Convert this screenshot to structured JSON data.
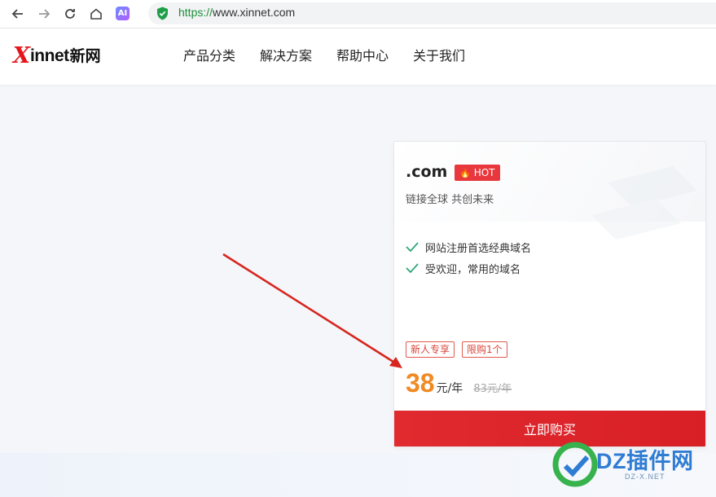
{
  "browser": {
    "url_scheme": "https://",
    "url_rest": "www.xinnet.com",
    "ai_label": "AI"
  },
  "site": {
    "logo_x": "X",
    "logo_rest": "innet",
    "logo_cn": "新网",
    "nav": [
      "产品分类",
      "解决方案",
      "帮助中心",
      "关于我们"
    ]
  },
  "card": {
    "title": ".com",
    "hot_label": "HOT",
    "subtitle": "链接全球 共创未来",
    "features": [
      "网站注册首选经典域名",
      "受欢迎，常用的域名"
    ],
    "tags": [
      "新人专享",
      "限购1个"
    ],
    "price": "38",
    "price_unit": "元/年",
    "old_price": "83元/年",
    "buy_label": "立即购买"
  },
  "watermark": {
    "text": "DZ插件网",
    "sub": "DZ-X.NET"
  },
  "colors": {
    "accent_red": "#e02a2f",
    "price_orange": "#f08a24",
    "check_green": "#2aa876",
    "annotation_red": "#d7261e"
  }
}
